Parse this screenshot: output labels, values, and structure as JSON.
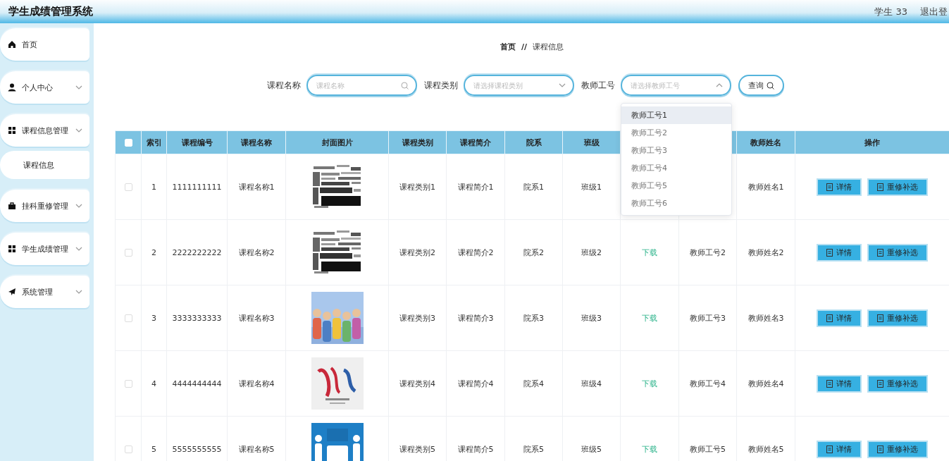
{
  "header": {
    "title": "学生成绩管理系统",
    "user": "学生 33",
    "logout": "退出登"
  },
  "sidebar": {
    "items": [
      {
        "label": "首页",
        "kind": "link"
      },
      {
        "label": "个人中心",
        "kind": "menu"
      },
      {
        "label": "课程信息管理",
        "kind": "menu",
        "children": [
          {
            "label": "课程信息"
          }
        ]
      },
      {
        "label": "挂科重修管理",
        "kind": "menu"
      },
      {
        "label": "学生成绩管理",
        "kind": "menu"
      },
      {
        "label": "系统管理",
        "kind": "menu"
      }
    ]
  },
  "breadcrumb": {
    "items": [
      "首页",
      "课程信息"
    ],
    "separator": "//"
  },
  "search": {
    "fields": [
      {
        "label": "课程名称",
        "placeholder": "课程名称",
        "kind": "search"
      },
      {
        "label": "课程类别",
        "placeholder": "请选择课程类别",
        "kind": "select",
        "expanded": false
      },
      {
        "label": "教师工号",
        "placeholder": "请选择教师工号",
        "kind": "select",
        "expanded": true,
        "options": [
          {
            "label": "教师工号1",
            "selected": true
          },
          {
            "label": "教师工号2",
            "selected": false
          },
          {
            "label": "教师工号3",
            "selected": false
          },
          {
            "label": "教师工号4",
            "selected": false
          },
          {
            "label": "教师工号5",
            "selected": false
          },
          {
            "label": "教师工号6",
            "selected": false
          }
        ]
      }
    ],
    "button": "查询"
  },
  "table": {
    "columns": [
      {
        "kind": "checkbox",
        "checked": false
      },
      {
        "kind": "text",
        "label": "索引"
      },
      {
        "kind": "text",
        "label": "课程编号"
      },
      {
        "kind": "text",
        "label": "课程名称"
      },
      {
        "kind": "text",
        "label": "封面图片"
      },
      {
        "kind": "text",
        "label": "课程类别"
      },
      {
        "kind": "text",
        "label": "课程简介"
      },
      {
        "kind": "text",
        "label": "院系"
      },
      {
        "kind": "text",
        "label": "班级"
      },
      {
        "kind": "covered"
      },
      {
        "kind": "covered"
      },
      {
        "kind": "text",
        "label": "教师姓名"
      },
      {
        "kind": "text",
        "label": "操作"
      }
    ],
    "rows": [
      {
        "checked": false,
        "index": "1",
        "code": "1111111111",
        "name": "课程名称1",
        "cover": {
          "kind": "picture"
        },
        "category": "课程类别1",
        "intro": "课程简介1",
        "department": "院系1",
        "class": "班级1",
        "teacher_name": "教师姓名1",
        "actions": [
          "详情",
          "重修补选"
        ]
      },
      {
        "checked": false,
        "index": "2",
        "code": "2222222222",
        "name": "课程名称2",
        "cover": {
          "kind": "picture"
        },
        "category": "课程类别2",
        "intro": "课程简介2",
        "department": "院系2",
        "class": "班级2",
        "file": "下载",
        "teacher_no": "教师工号2",
        "teacher_name": "教师姓名2",
        "actions": [
          "详情",
          "重修补选"
        ]
      },
      {
        "checked": false,
        "index": "3",
        "code": "3333333333",
        "name": "课程名称3",
        "cover": {
          "kind": "picture"
        },
        "category": "课程类别3",
        "intro": "课程简介3",
        "department": "院系3",
        "class": "班级3",
        "file": "下载",
        "teacher_no": "教师工号3",
        "teacher_name": "教师姓名3",
        "actions": [
          "详情",
          "重修补选"
        ]
      },
      {
        "checked": false,
        "index": "4",
        "code": "4444444444",
        "name": "课程名称4",
        "cover": {
          "kind": "picture"
        },
        "category": "课程类别4",
        "intro": "课程简介4",
        "department": "院系4",
        "class": "班级4",
        "file": "下载",
        "teacher_no": "教师工号4",
        "teacher_name": "教师姓名4",
        "actions": [
          "详情",
          "重修补选"
        ]
      },
      {
        "checked": false,
        "index": "5",
        "code": "5555555555",
        "name": "课程名称5",
        "cover": {
          "kind": "picture"
        },
        "category": "课程类别5",
        "intro": "课程简介5",
        "department": "院系5",
        "class": "班级5",
        "file": "下载",
        "teacher_no": "教师工号5",
        "teacher_name": "教师姓名5",
        "actions": [
          "详情",
          "重修补选"
        ]
      }
    ]
  }
}
